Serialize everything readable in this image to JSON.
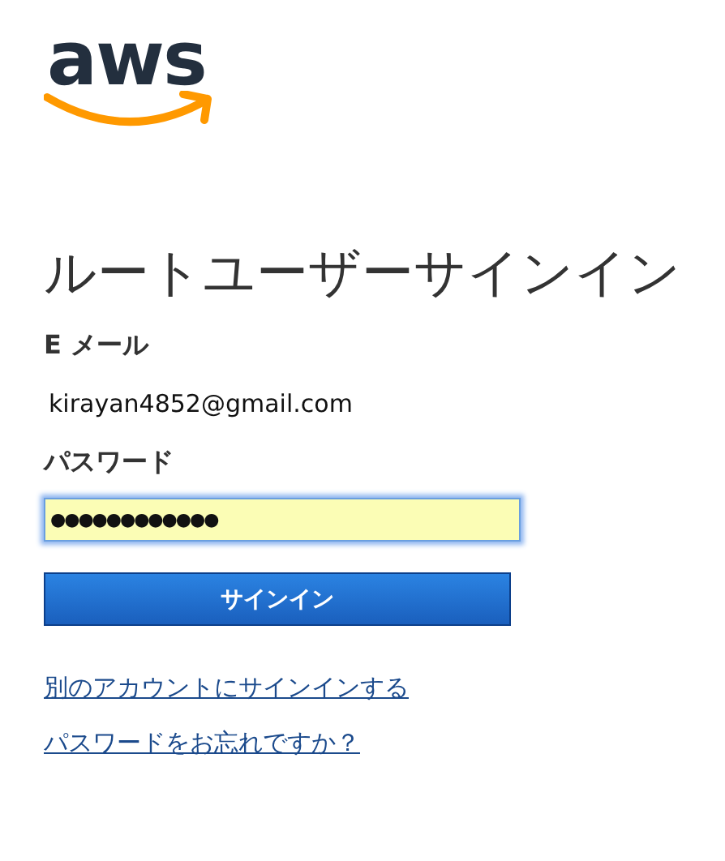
{
  "logo": {
    "text": "aws"
  },
  "title": "ルートユーザーサインイン",
  "email": {
    "label": "E メール",
    "value": "kirayan4852@gmail.com"
  },
  "password": {
    "label": "パスワード",
    "value": "●●●●●●●●●●●●",
    "focused": true
  },
  "sign_in_button": "サインイン",
  "links": [
    "別のアカウントにサインインする",
    "パスワードをお忘れですか？"
  ]
}
